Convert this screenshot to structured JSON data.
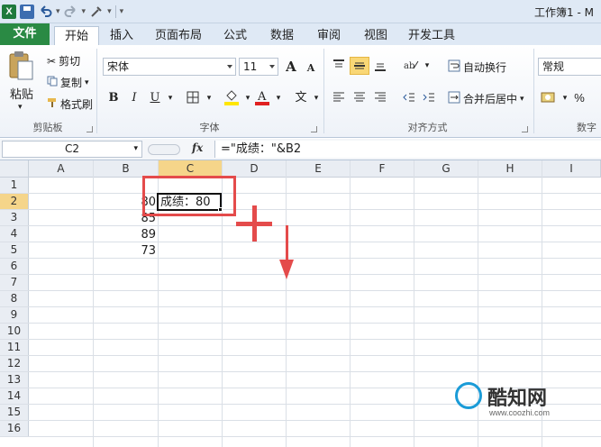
{
  "window": {
    "title": "工作簿1 - M"
  },
  "tabs": [
    "文件",
    "开始",
    "插入",
    "页面布局",
    "公式",
    "数据",
    "审阅",
    "视图",
    "开发工具"
  ],
  "ribbon": {
    "clipboard": {
      "paste": "粘贴",
      "cut": "剪切",
      "copy": "复制",
      "format_painter": "格式刷",
      "label": "剪贴板"
    },
    "font": {
      "name": "宋体",
      "size": "11",
      "label": "字体",
      "bold": "B",
      "italic": "I",
      "underline": "U",
      "grow": "A",
      "shrink": "A",
      "wen": "文"
    },
    "alignment": {
      "wrap": "自动换行",
      "merge": "合并后居中",
      "label": "对齐方式"
    },
    "number": {
      "format": "常规",
      "percent": "%",
      "label": "数字"
    }
  },
  "formula_bar": {
    "name_box": "C2",
    "fx": "fx",
    "formula": "=\"成绩：\"&B2"
  },
  "columns": [
    "A",
    "B",
    "C",
    "D",
    "E",
    "F",
    "G",
    "H",
    "I"
  ],
  "rows": [
    "1",
    "2",
    "3",
    "4",
    "5",
    "6",
    "7",
    "8",
    "9",
    "10",
    "11",
    "12",
    "13",
    "14",
    "15",
    "16"
  ],
  "cells": {
    "B2": "80",
    "B3": "85",
    "B4": "89",
    "B5": "73",
    "C2": "成绩：80"
  },
  "watermark": {
    "brand": "酷知网",
    "url": "www.coozhi.com"
  },
  "colors": {
    "file_tab": "#2a8a44",
    "selection": "#f5d58a",
    "annotation": "#e44b4b"
  }
}
